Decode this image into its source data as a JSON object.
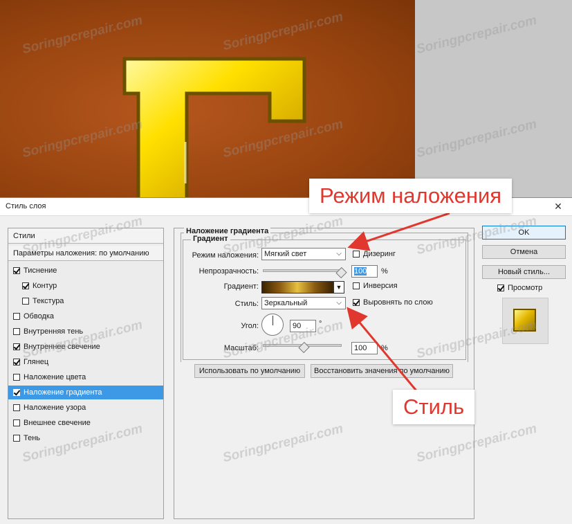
{
  "dialog": {
    "title": "Стиль слоя",
    "close_glyph": "✕"
  },
  "styles_list": {
    "header": "Стили",
    "blend_defaults": "Параметры наложения: по умолчанию",
    "items": [
      {
        "label": "Тиснение",
        "checked": true,
        "indent": false,
        "selected": false
      },
      {
        "label": "Контур",
        "checked": true,
        "indent": true,
        "selected": false
      },
      {
        "label": "Текстура",
        "checked": false,
        "indent": true,
        "selected": false
      },
      {
        "label": "Обводка",
        "checked": false,
        "indent": false,
        "selected": false
      },
      {
        "label": "Внутренняя тень",
        "checked": false,
        "indent": false,
        "selected": false
      },
      {
        "label": "Внутреннее свечение",
        "checked": true,
        "indent": false,
        "selected": false
      },
      {
        "label": "Глянец",
        "checked": true,
        "indent": false,
        "selected": false
      },
      {
        "label": "Наложение цвета",
        "checked": false,
        "indent": false,
        "selected": false
      },
      {
        "label": "Наложение градиента",
        "checked": true,
        "indent": false,
        "selected": true
      },
      {
        "label": "Наложение узора",
        "checked": false,
        "indent": false,
        "selected": false
      },
      {
        "label": "Внешнее свечение",
        "checked": false,
        "indent": false,
        "selected": false
      },
      {
        "label": "Тень",
        "checked": false,
        "indent": false,
        "selected": false
      }
    ]
  },
  "gradient_overlay": {
    "section_title": "Наложение градиента",
    "group_title": "Градиент",
    "blend_mode_label": "Режим наложения:",
    "blend_mode_value": "Мягкий свет",
    "dither_label": "Дизеринг",
    "dither_checked": false,
    "opacity_label": "Непрозрачность:",
    "opacity_value": "100",
    "opacity_unit": "%",
    "opacity_level": 1.0,
    "gradient_label": "Градиент:",
    "reverse_label": "Инверсия",
    "reverse_checked": false,
    "style_label": "Стиль:",
    "style_value": "Зеркальный",
    "align_label": "Выровнять по слою",
    "align_checked": true,
    "angle_label": "Угол:",
    "angle_value": "90",
    "angle_unit": "°",
    "scale_label": "Масштаб:",
    "scale_value": "100",
    "scale_unit": "%",
    "scale_level": 0.5,
    "make_default_label": "Использовать по умолчанию",
    "reset_default_label": "Восстановить значения по умолчанию"
  },
  "buttons": {
    "ok": "OK",
    "cancel": "Отмена",
    "new_style": "Новый стиль...",
    "preview_label": "Просмотр",
    "preview_checked": true
  },
  "callouts": {
    "blend_mode": "Режим наложения",
    "style": "Стиль"
  },
  "watermark": "Soringpcrepair.com",
  "colors": {
    "selection": "#3d98e6",
    "callout_text": "#e0372e",
    "canvas_bg": "#9a4510"
  }
}
